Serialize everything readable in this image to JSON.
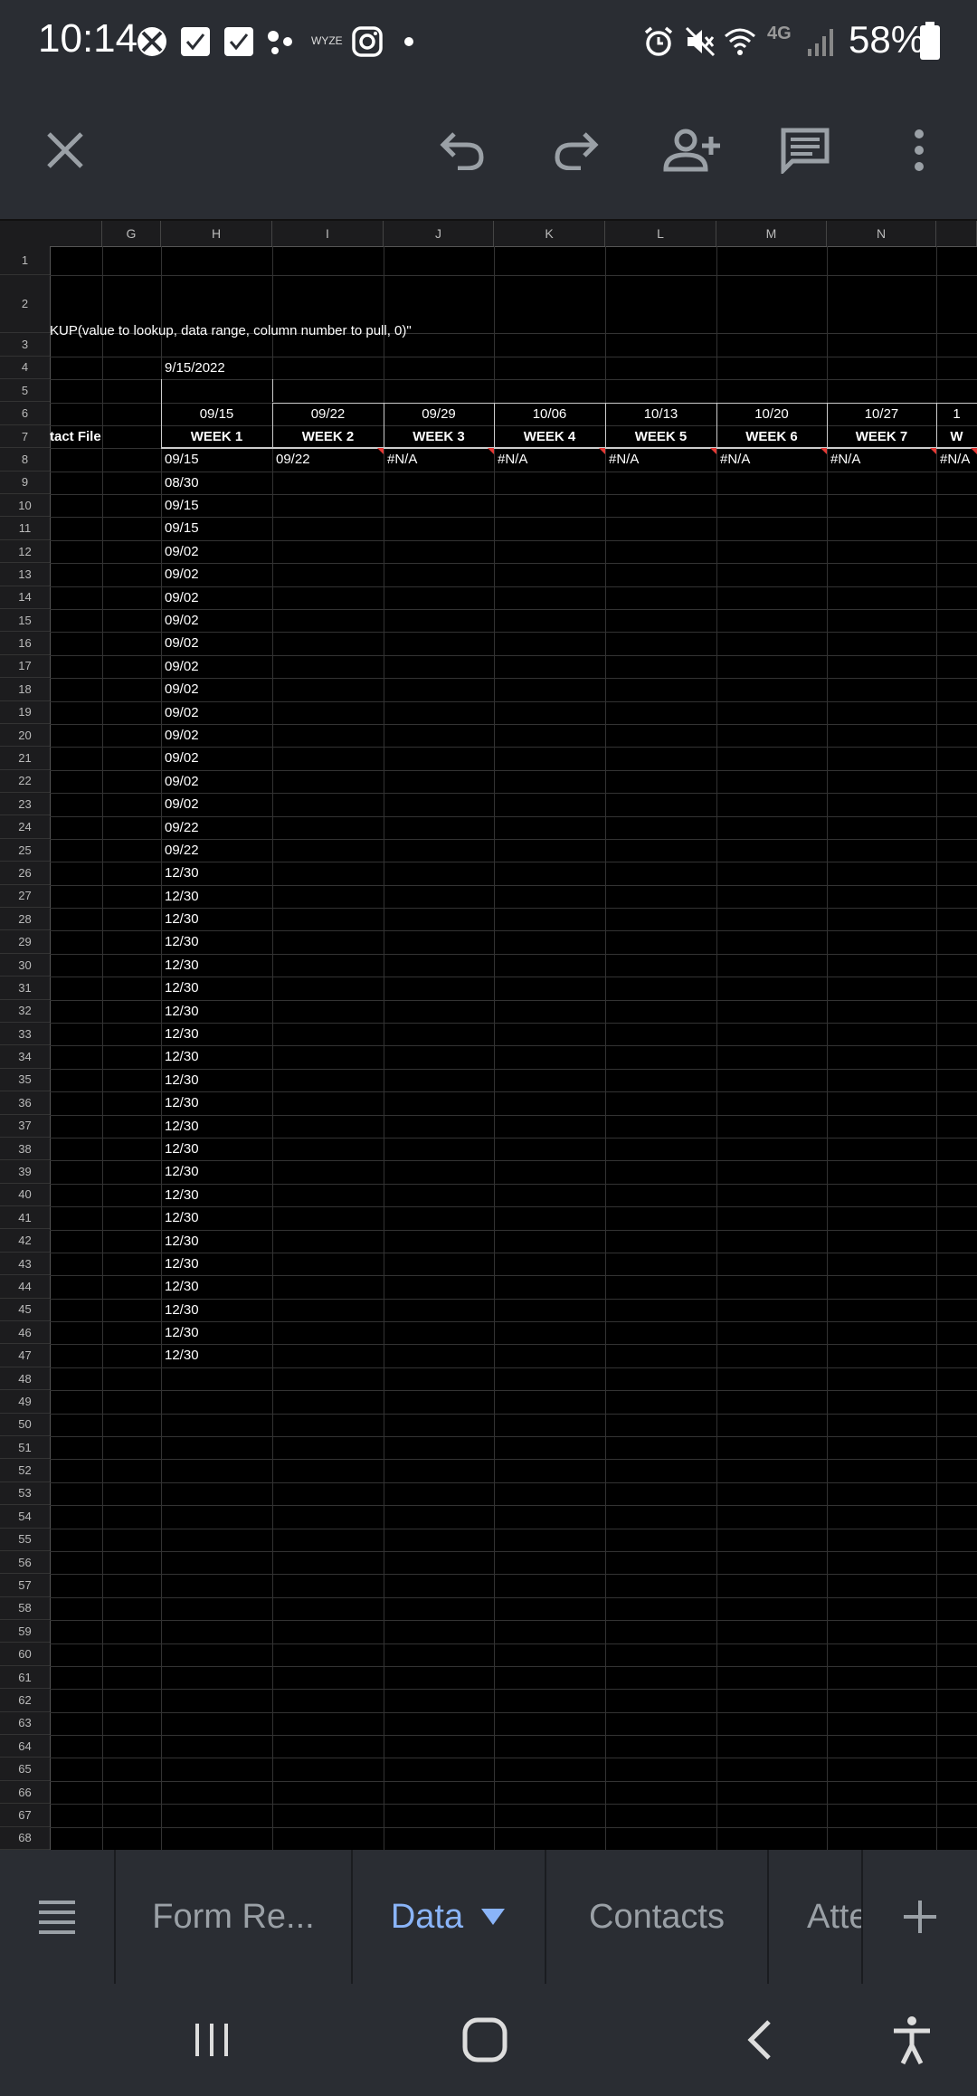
{
  "status_bar": {
    "time": "10:14",
    "battery_percent": "58%",
    "icons": [
      "xbox-icon",
      "call-filter-icon",
      "call-filter-icon",
      "dots-icon",
      "wyze-icon",
      "instagram-icon",
      "dot-icon",
      "alarm-icon",
      "mute-icon",
      "wifi-icon",
      "4g-icon",
      "signal-icon",
      "battery-icon"
    ],
    "wyze_label": "WYZE",
    "net_label": "4G"
  },
  "toolbar": {
    "icons": [
      "close-icon",
      "undo-icon",
      "redo-icon",
      "add-person-icon",
      "comment-icon",
      "more-vert-icon"
    ]
  },
  "sheet": {
    "columns": [
      "G",
      "H",
      "I",
      "J",
      "K",
      "L",
      "M",
      "N"
    ],
    "rows_first": 1,
    "rows_last": 68,
    "row2_text": "KUP(value to lookup, data range, column number to pull, 0)\"",
    "row4_h": "9/15/2022",
    "row6_dates": [
      "09/15",
      "09/22",
      "09/29",
      "10/06",
      "10/13",
      "10/20",
      "10/27",
      "1"
    ],
    "row7_label_f": "tact File",
    "row7_weeks": [
      "WEEK 1",
      "WEEK 2",
      "WEEK 3",
      "WEEK 4",
      "WEEK 5",
      "WEEK 6",
      "WEEK 7",
      "W"
    ],
    "row8": [
      "09/15",
      "09/22",
      "#N/A",
      "#N/A",
      "#N/A",
      "#N/A",
      "#N/A",
      "#N/A"
    ],
    "col_h_values": [
      "08/30",
      "09/15",
      "09/15",
      "09/02",
      "09/02",
      "09/02",
      "09/02",
      "09/02",
      "09/02",
      "09/02",
      "09/02",
      "09/02",
      "09/02",
      "09/02",
      "09/02",
      "09/22",
      "09/22",
      "12/30",
      "12/30",
      "12/30",
      "12/30",
      "12/30",
      "12/30",
      "12/30",
      "12/30",
      "12/30",
      "12/30",
      "12/30",
      "12/30",
      "12/30",
      "12/30",
      "12/30",
      "12/30",
      "12/30",
      "12/30",
      "12/30",
      "12/30",
      "12/30",
      "12/30"
    ]
  },
  "tabs": {
    "items": [
      {
        "label": "Form Re...",
        "active": false
      },
      {
        "label": "Data",
        "active": true
      },
      {
        "label": "Contacts",
        "active": false
      },
      {
        "label": "Atte",
        "active": false
      }
    ],
    "accent": "#8ab4f8"
  },
  "nav": {
    "icons": [
      "recents-icon",
      "home-icon",
      "back-icon",
      "accessibility-icon"
    ]
  }
}
